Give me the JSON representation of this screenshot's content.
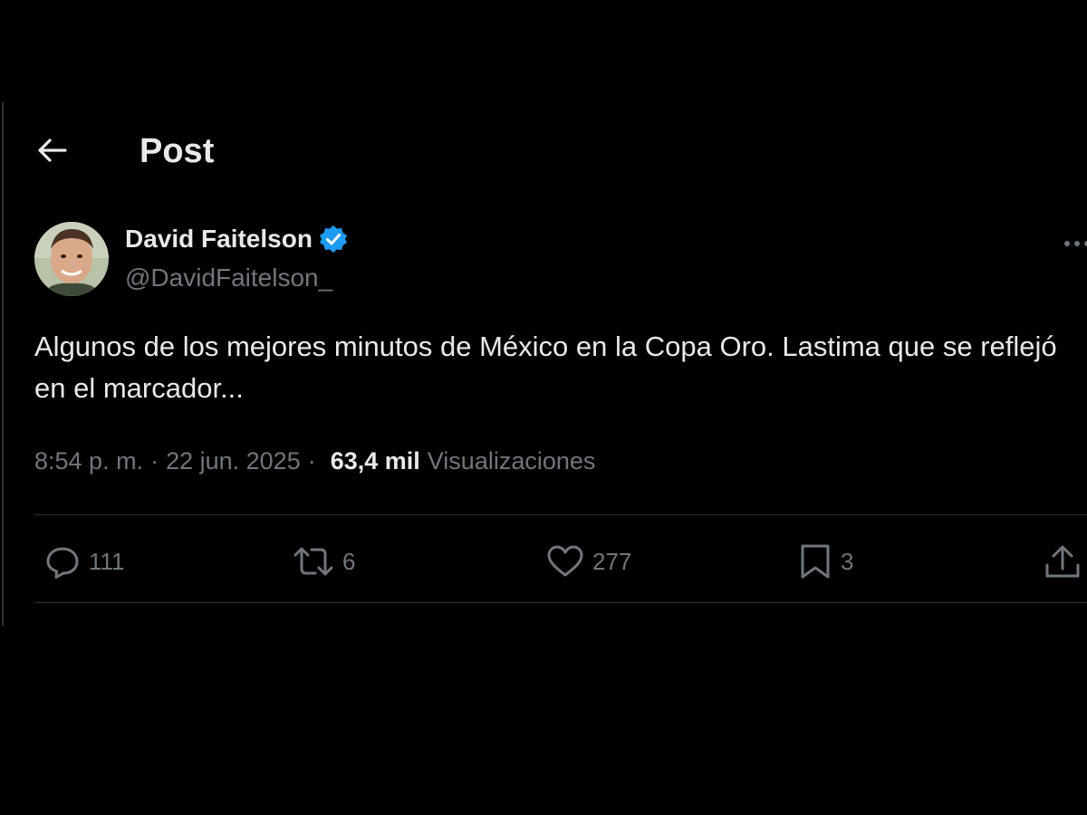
{
  "header": {
    "title": "Post"
  },
  "author": {
    "display_name": "David Faitelson",
    "handle": "@DavidFaitelson_",
    "verified": true
  },
  "tweet": {
    "text": "Algunos de los mejores minutos de México en la Copa Oro. Lastima que se reflejó en el marcador..."
  },
  "meta": {
    "time": "8:54 p. m.",
    "separator": "·",
    "date": "22 jun. 2025",
    "separator2": "·",
    "views_count": "63,4 mil",
    "views_label": "Visualizaciones"
  },
  "actions": {
    "replies": "111",
    "reposts": "6",
    "likes": "277",
    "bookmarks": "3"
  },
  "colors": {
    "background": "#000000",
    "text_primary": "#e7e9ea",
    "text_secondary": "#71767b",
    "divider": "#2f3336",
    "verified_badge": "#1d9bf0"
  },
  "icons": {
    "back": "arrow-left-icon",
    "verified": "verified-badge-icon",
    "more": "more-horizontal-icon",
    "reply": "reply-icon",
    "repost": "repost-icon",
    "like": "heart-icon",
    "bookmark": "bookmark-icon",
    "share": "share-icon"
  }
}
